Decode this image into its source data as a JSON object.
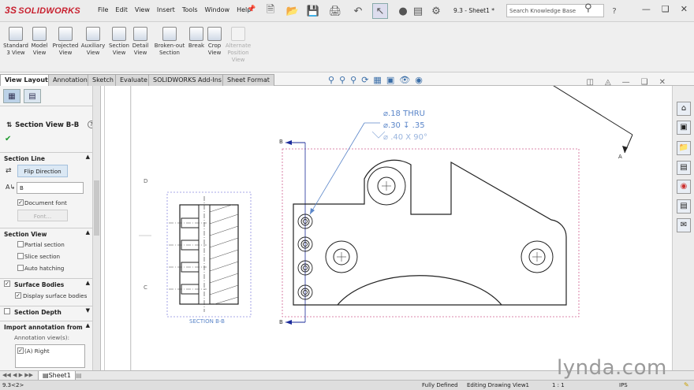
{
  "app": {
    "logo_prefix": "3S",
    "logo_name": "SOLIDWORKS"
  },
  "menu": [
    "File",
    "Edit",
    "View",
    "Insert",
    "Tools",
    "Window",
    "Help"
  ],
  "doc_name": "9.3 - Sheet1 *",
  "search": {
    "placeholder": "Search Knowledge Base"
  },
  "commands": [
    {
      "label": "Standard\n3 View"
    },
    {
      "label": "Model\nView"
    },
    {
      "label": "Projected\nView"
    },
    {
      "label": "Auxiliary\nView"
    },
    {
      "label": "Section\nView"
    },
    {
      "label": "Detail\nView"
    },
    {
      "label": "Broken-out\nSection"
    },
    {
      "label": "Break"
    },
    {
      "label": "Crop\nView"
    },
    {
      "label": "Alternate\nPosition\nView"
    }
  ],
  "tabs": [
    "View Layout",
    "Annotation",
    "Sketch",
    "Evaluate",
    "SOLIDWORKS Add-Ins",
    "Sheet Format"
  ],
  "panel": {
    "title": "Section View B-B",
    "help": "?",
    "section_line": {
      "title": "Section Line",
      "flip_direction": "Flip Direction",
      "label_value": "B",
      "document_font": "Document font",
      "font_button": "Font..."
    },
    "section_view": {
      "title": "Section View",
      "partial_section": "Partial section",
      "slice_section": "Slice section",
      "auto_hatching": "Auto hatching"
    },
    "surface_bodies": {
      "title": "Surface Bodies",
      "display_surface_bodies": "Display surface bodies"
    },
    "section_depth": {
      "title": "Section Depth"
    },
    "import_annotation": {
      "title": "Import annotation from",
      "annotation_views": "Annotation view(s):",
      "right_view": "(A) Right"
    }
  },
  "drawing": {
    "callout_line1": "⌀.18 THRU",
    "callout_line2": "⌀.30 ↧ .35",
    "callout_line3": "⌀ .40 X 90°",
    "section_label": "SECTION B-B",
    "marker_top": "B",
    "marker_bottom": "B",
    "marker_a": "A",
    "border_d": "D",
    "border_c": "C"
  },
  "sheet_tab": "Sheet1",
  "status": {
    "left": "9.3<2>",
    "defined": "Fully Defined",
    "editing": "Editing Drawing View1",
    "scale": "1 : 1",
    "units": "IPS"
  },
  "watermark": "lynda.com",
  "colors": {
    "accent": "#3a78c2",
    "brand": "#c8202f",
    "callout": "#5b86c9",
    "section_arrow": "#1a2a9a",
    "bounding": "#d06090"
  }
}
